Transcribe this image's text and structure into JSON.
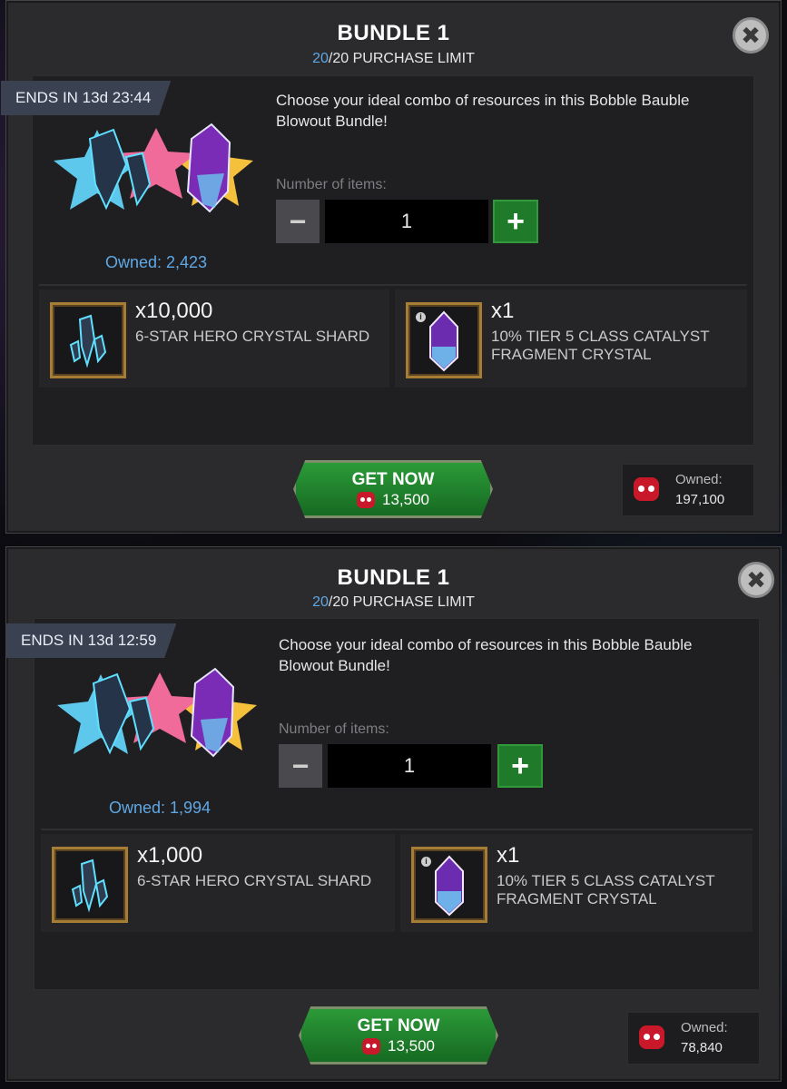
{
  "bundles": [
    {
      "title": "BUNDLE 1",
      "limit_current": "20",
      "limit_rest": "/20 PURCHASE LIMIT",
      "ends_in": "ENDS IN 13d 23:44",
      "owned": "Owned: 2,423",
      "description": "Choose your ideal combo of resources in this Bobble Bauble Blowout Bundle!",
      "number_label": "Number of items:",
      "quantity": "1",
      "minus_label": "−",
      "plus_label": "+",
      "items": [
        {
          "qty": "x10,000",
          "name": "6-STAR HERO CRYSTAL SHARD",
          "icon": "crystal-shard-icon"
        },
        {
          "qty": "x1",
          "name": "10% TIER 5 CLASS CATALYST FRAGMENT CRYSTAL",
          "icon": "catalyst-crystal-icon"
        }
      ],
      "get_now_label": "GET NOW",
      "price": "13,500",
      "units_owned_label": "Owned:",
      "units_owned_value": "197,100"
    },
    {
      "title": "BUNDLE 1",
      "limit_current": "20",
      "limit_rest": "/20 PURCHASE LIMIT",
      "ends_in": "ENDS IN 13d 12:59",
      "owned": "Owned: 1,994",
      "description": "Choose your ideal combo of resources in this Bobble Bauble Blowout Bundle!",
      "number_label": "Number of items:",
      "quantity": "1",
      "minus_label": "−",
      "plus_label": "+",
      "items": [
        {
          "qty": "x1,000",
          "name": "6-STAR HERO CRYSTAL SHARD",
          "icon": "crystal-shard-icon"
        },
        {
          "qty": "x1",
          "name": "10% TIER 5 CLASS CATALYST FRAGMENT CRYSTAL",
          "icon": "catalyst-crystal-icon"
        }
      ],
      "get_now_label": "GET NOW",
      "price": "13,500",
      "units_owned_label": "Owned:",
      "units_owned_value": "78,840"
    }
  ],
  "close_symbol": "✖",
  "colors": {
    "accent_blue": "#5fa8e6",
    "button_green": "#2c9a38",
    "frame_gold": "#a57d35",
    "units_red": "#c8182a"
  }
}
